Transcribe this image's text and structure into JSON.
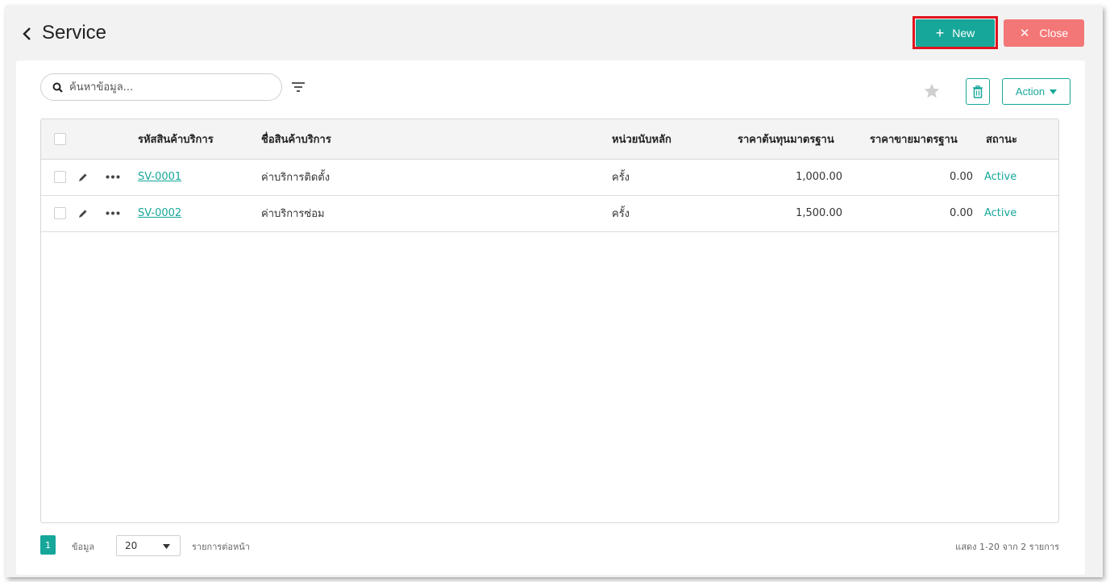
{
  "header": {
    "title": "Service",
    "new_label": "New",
    "close_label": "Close"
  },
  "toolbar": {
    "search_placeholder": "ค้นหาข้อมูล...",
    "action_label": "Action"
  },
  "table": {
    "columns": [
      "รหัสสินค้าบริการ",
      "ชื่อสินค้าบริการ",
      "หน่วยนับหลัก",
      "ราคาต้นทุนมาตรฐาน",
      "ราคาขายมาตรฐาน",
      "สถานะ"
    ],
    "rows": [
      {
        "code": "SV-0001",
        "name": "ค่าบริการติดตั้ง",
        "unit": "ครั้ง",
        "cost": "1,000.00",
        "price": "0.00",
        "status": "Active"
      },
      {
        "code": "SV-0002",
        "name": "ค่าบริการซ่อม",
        "unit": "ครั้ง",
        "cost": "1,500.00",
        "price": "0.00",
        "status": "Active"
      }
    ]
  },
  "pager": {
    "current_page": "1",
    "data_label": "ข้อมูล",
    "per_page": "20",
    "per_page_label": "รายการต่อหน้า",
    "summary": "แสดง 1-20 จาก 2 รายการ"
  },
  "colors": {
    "accent": "#16a79a",
    "close": "#f47777",
    "highlight": "#e0141e"
  }
}
